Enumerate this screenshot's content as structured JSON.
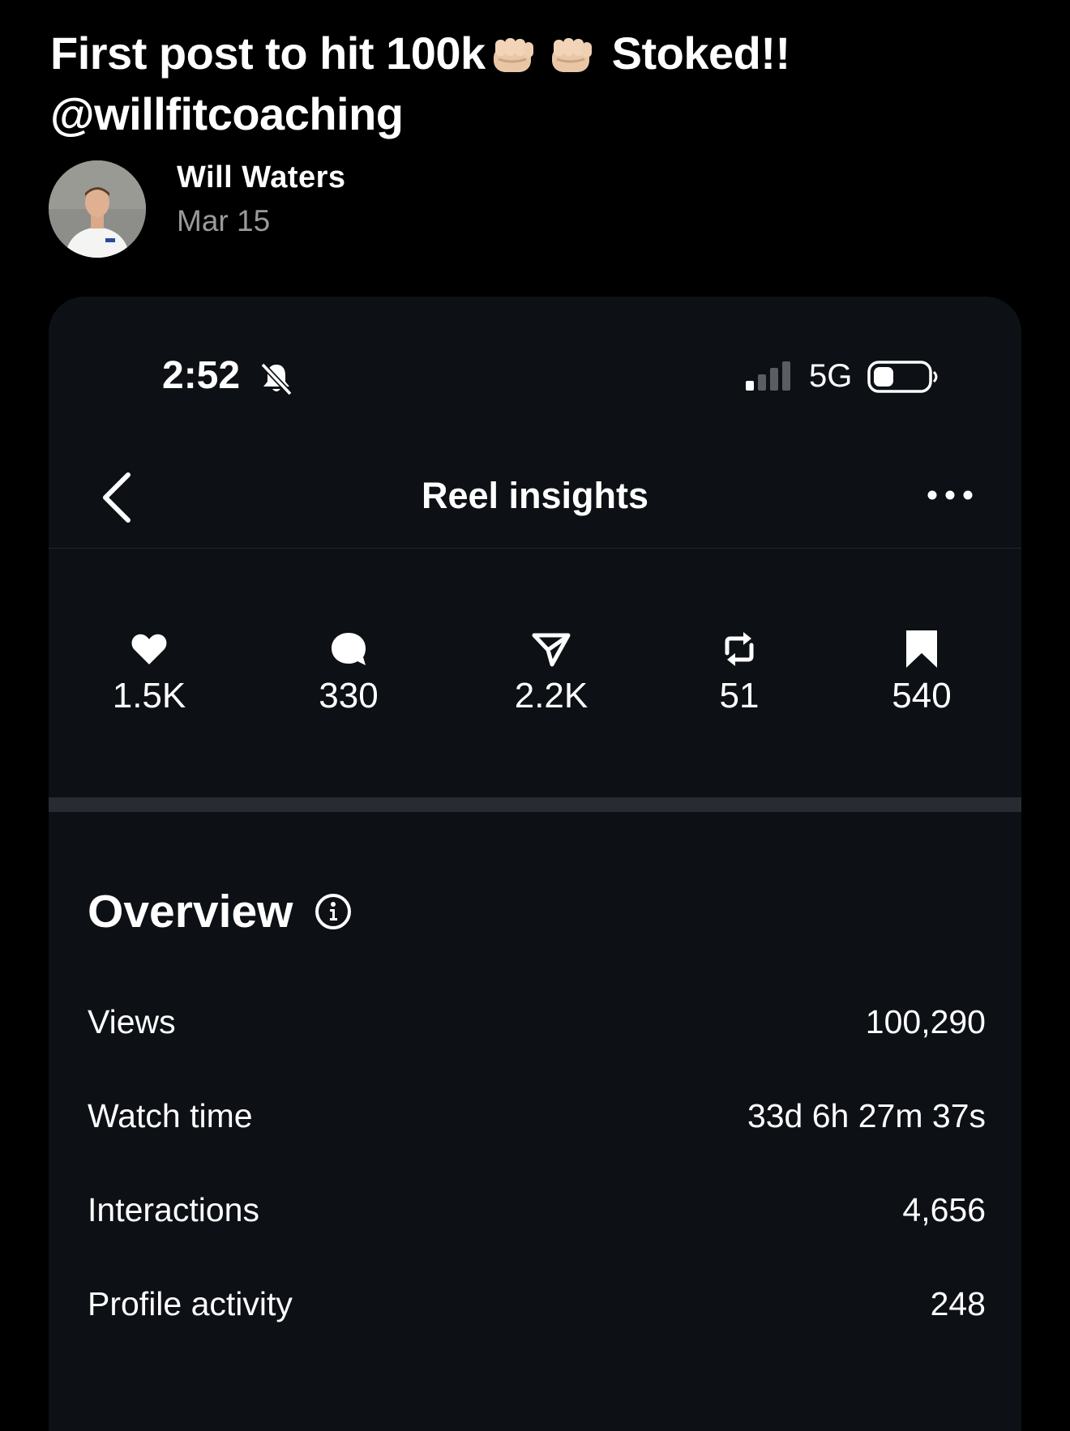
{
  "post": {
    "caption_line1_before": "First post to hit 100k",
    "caption_emoji": "👊🏼👊🏼",
    "caption_line1_after": "Stoked!!",
    "caption_line2": "@willfitcoaching",
    "author_name": "Will Waters",
    "date": "Mar 15"
  },
  "screenshot": {
    "status_bar": {
      "time": "2:52",
      "network": "5G",
      "silent_icon": "bell-slash-icon",
      "signal_bars": 1
    },
    "nav": {
      "title": "Reel insights",
      "back_icon": "chevron-left-icon",
      "more_icon": "ellipsis-icon"
    },
    "stats": [
      {
        "icon": "heart-icon",
        "value": "1.5K"
      },
      {
        "icon": "comment-icon",
        "value": "330"
      },
      {
        "icon": "send-icon",
        "value": "2.2K"
      },
      {
        "icon": "repost-icon",
        "value": "51"
      },
      {
        "icon": "bookmark-icon",
        "value": "540"
      }
    ],
    "overview": {
      "title": "Overview",
      "rows": [
        {
          "label": "Views",
          "value": "100,290"
        },
        {
          "label": "Watch time",
          "value": "33d 6h 27m 37s"
        },
        {
          "label": "Interactions",
          "value": "4,656"
        },
        {
          "label": "Profile activity",
          "value": "248"
        }
      ]
    }
  },
  "colors": {
    "page_bg": "#000000",
    "card_bg": "#0d1015",
    "divider": "#282c32",
    "muted_text": "#9a9a9a"
  }
}
